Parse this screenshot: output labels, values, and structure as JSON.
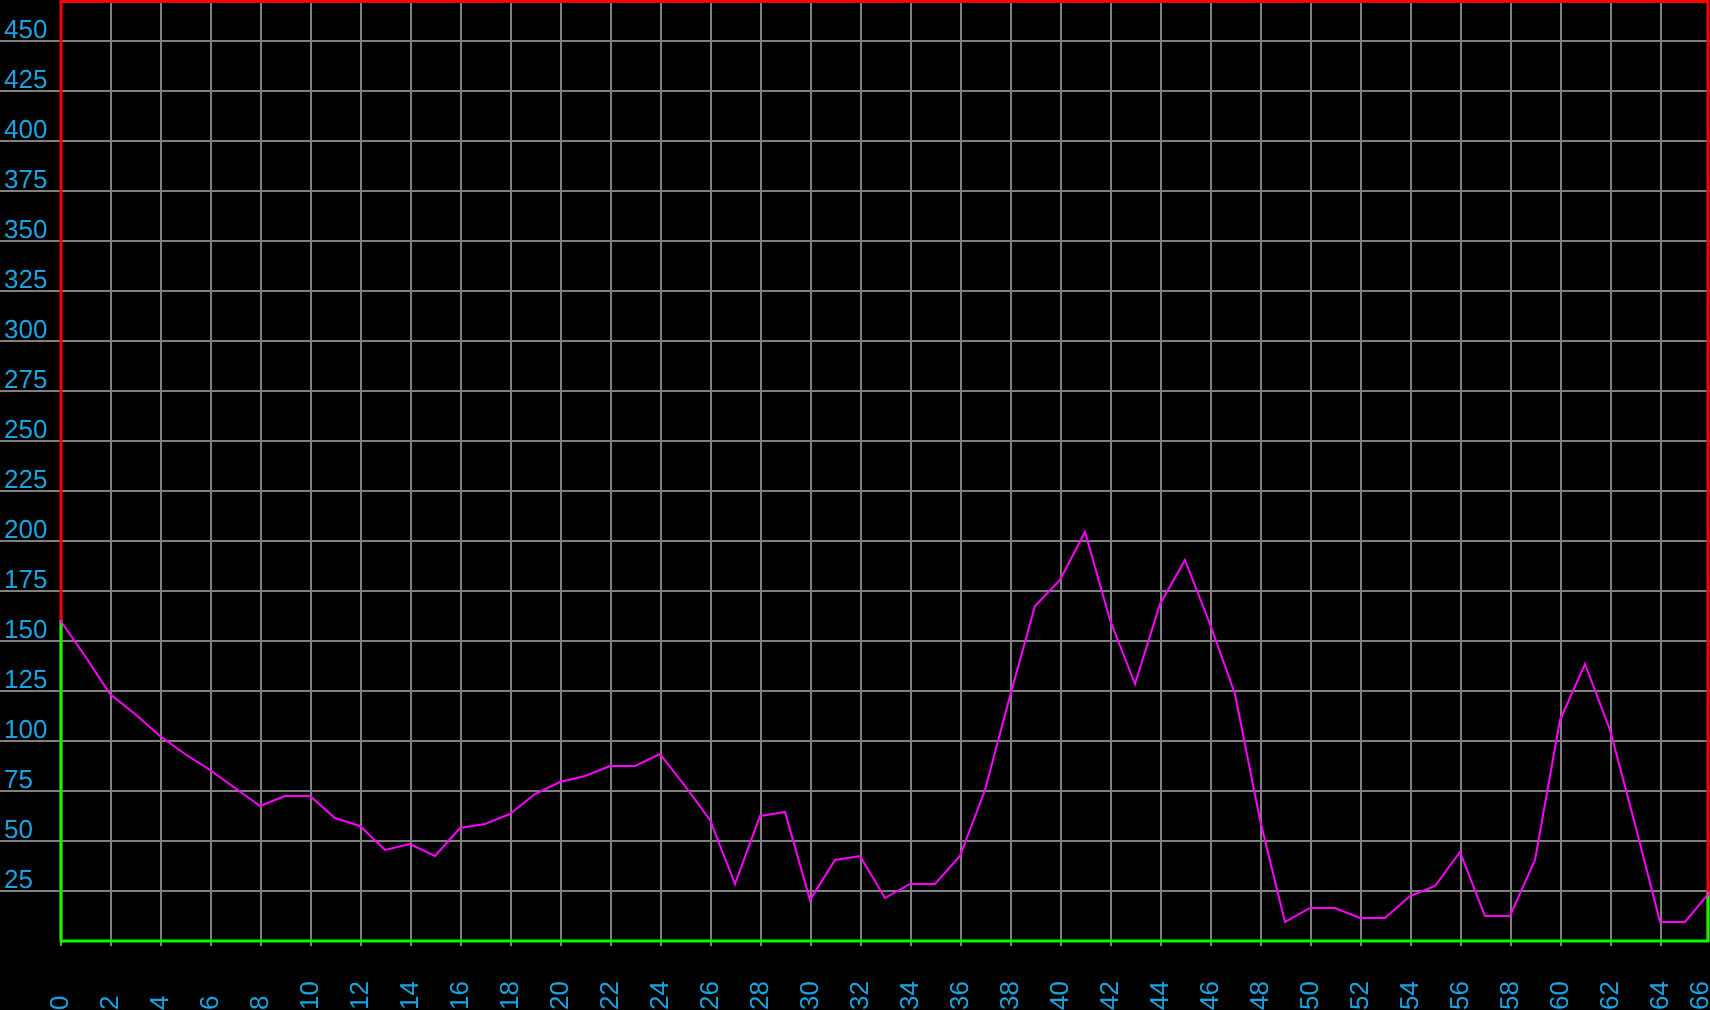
{
  "chart": {
    "chart_data": {
      "type": "line",
      "x": [
        0,
        1,
        2,
        3,
        4,
        5,
        6,
        7,
        8,
        9,
        10,
        11,
        12,
        13,
        14,
        15,
        16,
        17,
        18,
        19,
        20,
        21,
        22,
        23,
        24,
        25,
        26,
        27,
        28,
        29,
        30,
        31,
        32,
        33,
        34,
        35,
        36,
        37,
        38,
        39,
        40,
        41,
        42,
        43,
        44,
        45,
        46,
        47,
        48,
        49,
        50,
        51,
        52,
        53,
        54,
        55,
        56,
        57,
        58,
        59,
        60,
        61,
        62,
        63,
        64,
        65,
        66
      ],
      "grid": true,
      "series": [
        {
          "color": "#ff00ff",
          "values": [
            160,
            142,
            123,
            113,
            102,
            93,
            85,
            76,
            67,
            72,
            72,
            61,
            57,
            45,
            48,
            42,
            56,
            58,
            63,
            73,
            79,
            82,
            87,
            87,
            93,
            77,
            60,
            28,
            62,
            64,
            20,
            40,
            42,
            21,
            28,
            28,
            42,
            75,
            122,
            167,
            180,
            204,
            160,
            128,
            168,
            190,
            158,
            123,
            60,
            9,
            16,
            16,
            11,
            11,
            22,
            27,
            44,
            12,
            12,
            40,
            110,
            138,
            105,
            58,
            9,
            9,
            24
          ]
        }
      ],
      "xlim": [
        0,
        66
      ],
      "ylim": [
        0,
        470
      ],
      "xticks": [
        0,
        2,
        4,
        6,
        8,
        10,
        12,
        14,
        16,
        18,
        20,
        22,
        24,
        26,
        28,
        30,
        32,
        34,
        36,
        38,
        40,
        42,
        44,
        46,
        48,
        50,
        52,
        54,
        56,
        58,
        60,
        62,
        64,
        66
      ],
      "yticks": [
        25,
        50,
        75,
        100,
        125,
        150,
        175,
        200,
        225,
        250,
        275,
        300,
        325,
        350,
        375,
        400,
        425,
        450
      ]
    }
  }
}
